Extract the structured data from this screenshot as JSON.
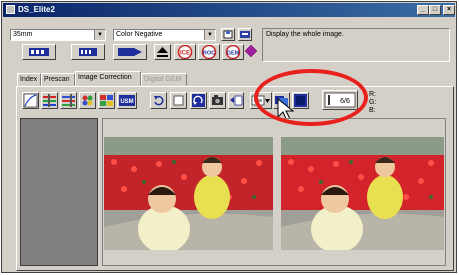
{
  "window": {
    "title": "DS_Elite2",
    "controls": [
      "_",
      "□",
      "×"
    ]
  },
  "top": {
    "film_format": "35mm",
    "film_type": "Color Negative",
    "status_message": "Display the whole image."
  },
  "buttons": {
    "ice": "ICE",
    "roc": "ROC",
    "gem": "GEM"
  },
  "tabs": [
    {
      "label": "Index",
      "state": "normal"
    },
    {
      "label": "Prescan",
      "state": "normal"
    },
    {
      "label": "Image Correction",
      "state": "active"
    },
    {
      "label": "Digital GEM",
      "state": "disabled"
    }
  ],
  "toolbar": {
    "usm_label": "USM",
    "frame_counter": "6/6"
  },
  "readout": {
    "r": "R:",
    "g": "G:",
    "b": "B:"
  },
  "colors": {
    "titlebar": "#0a246a",
    "highlight_circle": "#e8211d",
    "ice_red": "#cc2222"
  },
  "icons": [
    "app-icon",
    "minimize-icon",
    "maximize-icon",
    "close-icon",
    "dropdown-arrow-icon",
    "save-icon",
    "printer-icon",
    "preferences-icon",
    "prescan-icon",
    "scan-icon",
    "eject-icon",
    "ice-icon",
    "roc-icon",
    "gem-icon",
    "eraser-icon",
    "variation-icon",
    "tone-curve-icon",
    "levels-icon",
    "color-balance-icon",
    "unsharp-mask-icon",
    "undo-icon",
    "reset-icon",
    "rotate-icon",
    "snapshot-icon",
    "crop-icon",
    "before-after-icon",
    "full-image-icon",
    "fit-window-icon",
    "frame-counter-icon",
    "cursor-icon"
  ]
}
